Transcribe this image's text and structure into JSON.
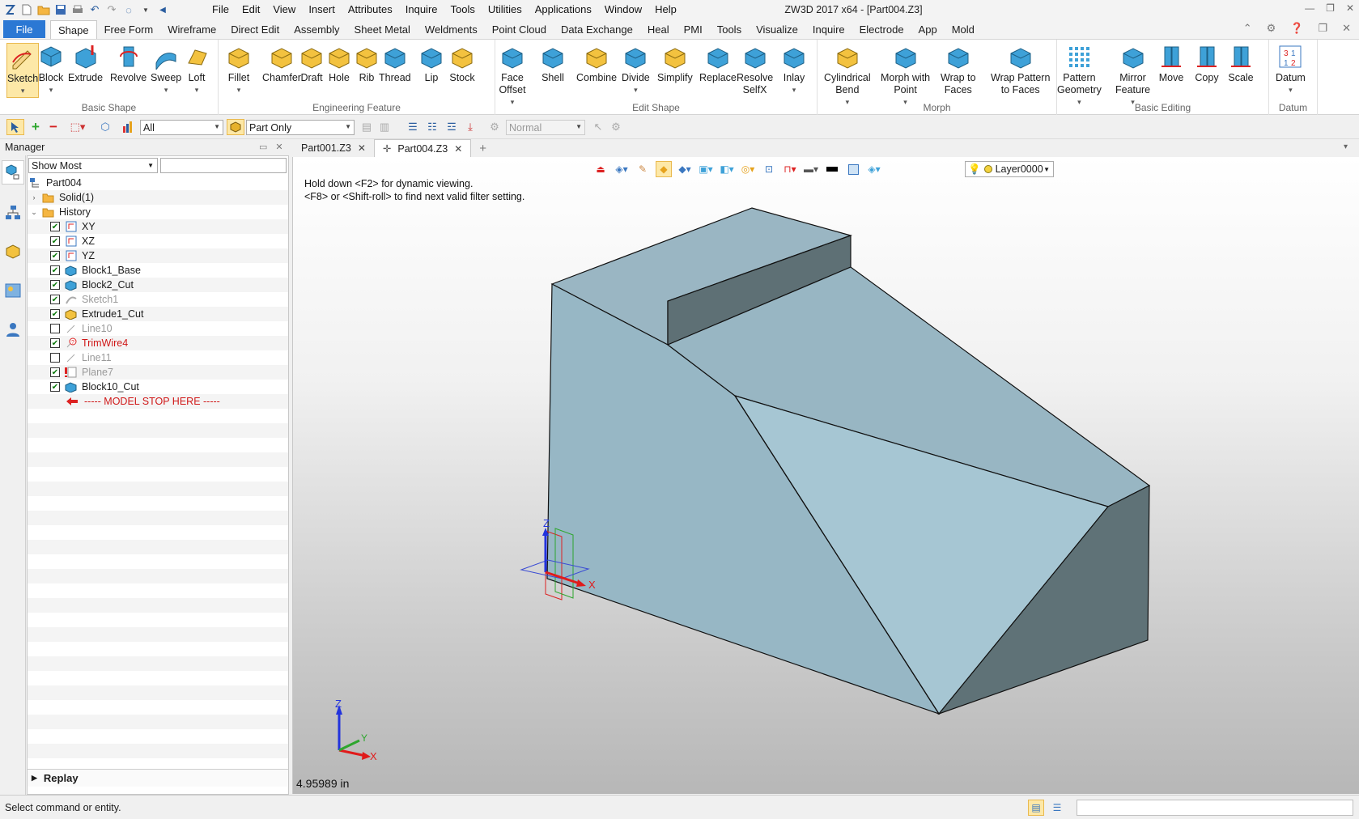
{
  "app_title": "ZW3D 2017  x64 - [Part004.Z3]",
  "menu": [
    "File",
    "Edit",
    "View",
    "Insert",
    "Attributes",
    "Inquire",
    "Tools",
    "Utilities",
    "Applications",
    "Window",
    "Help"
  ],
  "file_tab": "File",
  "ribbon_tabs": [
    "Shape",
    "Free Form",
    "Wireframe",
    "Direct Edit",
    "Assembly",
    "Sheet Metal",
    "Weldments",
    "Point Cloud",
    "Data Exchange",
    "Heal",
    "PMI",
    "Tools",
    "Visualize",
    "Inquire",
    "Electrode",
    "App",
    "Mold"
  ],
  "active_ribbon_tab": "Shape",
  "groups": {
    "basic_shape": {
      "label": "Basic Shape",
      "buttons": [
        "Sketch",
        "Block",
        "Extrude",
        "Revolve",
        "Sweep",
        "Loft"
      ]
    },
    "engineering": {
      "label": "Engineering Feature",
      "buttons": [
        "Fillet",
        "Chamfer",
        "Draft",
        "Hole",
        "Rib",
        "Thread",
        "Lip",
        "Stock"
      ]
    },
    "edit_shape": {
      "label": "Edit Shape",
      "buttons": [
        "Face\nOffset",
        "Shell",
        "Combine",
        "Divide",
        "Simplify",
        "Replace",
        "Resolve\nSelfX",
        "Inlay"
      ]
    },
    "morph": {
      "label": "Morph",
      "buttons": [
        "Cylindrical\nBend",
        "Morph with\nPoint",
        "Wrap to\nFaces",
        "Wrap Pattern\nto Faces"
      ]
    },
    "basic_editing": {
      "label": "Basic Editing",
      "buttons": [
        "Pattern\nGeometry",
        "Mirror\nFeature",
        "Move",
        "Copy",
        "Scale"
      ]
    },
    "datum": {
      "label": "Datum",
      "buttons": [
        "Datum"
      ]
    }
  },
  "toolbar": {
    "filter_value": "All",
    "scope_value": "Part Only",
    "render_value": "Normal"
  },
  "manager": {
    "title": "Manager",
    "show_value": "Show Most",
    "tree": [
      {
        "label": "Part004",
        "level": 0,
        "type": "part",
        "expander": "",
        "check": "none",
        "style": ""
      },
      {
        "label": "Solid(1)",
        "level": 1,
        "type": "folder",
        "expander": "›",
        "check": "none",
        "style": ""
      },
      {
        "label": "History",
        "level": 1,
        "type": "folder",
        "expander": "⌄",
        "check": "none",
        "style": ""
      },
      {
        "label": "XY",
        "level": 2,
        "type": "plane",
        "check": "on",
        "style": ""
      },
      {
        "label": "XZ",
        "level": 2,
        "type": "plane",
        "check": "on",
        "style": ""
      },
      {
        "label": "YZ",
        "level": 2,
        "type": "plane",
        "check": "on",
        "style": ""
      },
      {
        "label": "Block1_Base",
        "level": 2,
        "type": "block",
        "check": "on",
        "style": ""
      },
      {
        "label": "Block2_Cut",
        "level": 2,
        "type": "block",
        "check": "on",
        "style": ""
      },
      {
        "label": "Sketch1",
        "level": 2,
        "type": "sketch",
        "check": "on",
        "style": "dim"
      },
      {
        "label": "Extrude1_Cut",
        "level": 2,
        "type": "extrude",
        "check": "on",
        "style": ""
      },
      {
        "label": "Line10",
        "level": 2,
        "type": "line",
        "check": "off",
        "style": "dim"
      },
      {
        "label": "TrimWire4",
        "level": 2,
        "type": "trim",
        "check": "on",
        "style": "red"
      },
      {
        "label": "Line11",
        "level": 2,
        "type": "line",
        "check": "off",
        "style": "dim"
      },
      {
        "label": "Plane7",
        "level": 2,
        "type": "plane-err",
        "check": "on",
        "style": "dim"
      },
      {
        "label": "Block10_Cut",
        "level": 2,
        "type": "block",
        "check": "on",
        "style": ""
      },
      {
        "label": "----- MODEL STOP HERE -----",
        "level": 2,
        "type": "stop",
        "check": "none",
        "style": "red"
      }
    ],
    "replay": "Replay"
  },
  "doc_tabs": [
    {
      "label": "Part001.Z3",
      "active": false
    },
    {
      "label": "Part004.Z3",
      "active": true
    }
  ],
  "viewport": {
    "hint_lines": [
      "Hold down <F2> for dynamic viewing.",
      "<F8> or <Shift-roll> to find next valid filter setting."
    ],
    "layer": "Layer0000",
    "measure": "4.95989 in",
    "axis_labels": {
      "x": "X",
      "y": "Y",
      "z": "Z"
    }
  },
  "status": "Select command or entity.",
  "colors": {
    "accent": "#2b78d4",
    "solid_face": "#9ab6c3",
    "solid_dark": "#5e7075",
    "error": "#d01818"
  }
}
